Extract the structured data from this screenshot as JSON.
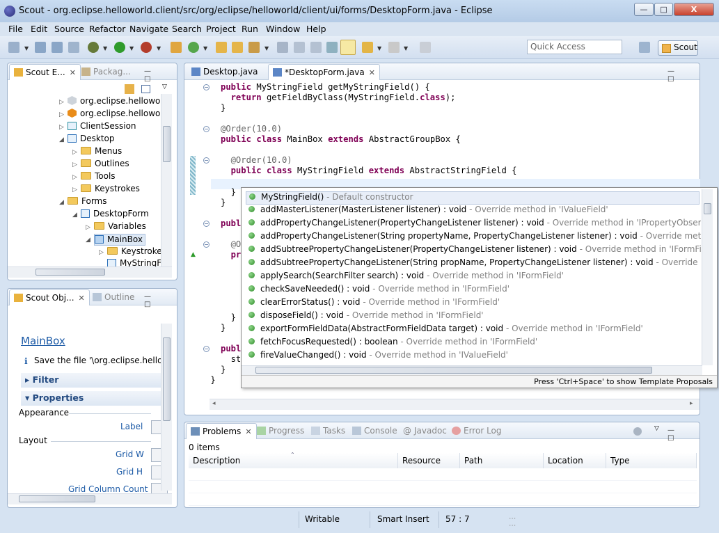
{
  "window": {
    "title": "Scout - org.eclipse.helloworld.client/src/org/eclipse/helloworld/client/ui/forms/DesktopForm.java - Eclipse",
    "min": "—",
    "max": "□",
    "close": "X"
  },
  "menu": [
    "File",
    "Edit",
    "Source",
    "Refactor",
    "Navigate",
    "Search",
    "Project",
    "Run",
    "Window",
    "Help"
  ],
  "toolbar": {
    "quick_access_placeholder": "Quick Access",
    "perspective": "Scout"
  },
  "explorer": {
    "tabs": [
      {
        "label": "Scout E...",
        "active": true
      },
      {
        "label": "Packag...",
        "active": false
      }
    ],
    "tree": [
      {
        "label": "org.eclipse.helloworld",
        "icon": "project-icon-gray"
      },
      {
        "label": "org.eclipse.helloworld",
        "icon": "project-icon-orange"
      },
      {
        "label": "ClientSession",
        "icon": "session-icon"
      },
      {
        "label": "Desktop",
        "icon": "desktop-icon"
      },
      {
        "label": "Menus",
        "icon": "folder-icon"
      },
      {
        "label": "Outlines",
        "icon": "folder-icon"
      },
      {
        "label": "Tools",
        "icon": "folder-icon"
      },
      {
        "label": "Keystrokes",
        "icon": "folder-icon"
      },
      {
        "label": "Forms",
        "icon": "folder-icon"
      },
      {
        "label": "DesktopForm",
        "icon": "form-icon"
      },
      {
        "label": "Variables",
        "icon": "folder-icon"
      },
      {
        "label": "MainBox",
        "icon": "groupbox-icon"
      },
      {
        "label": "Keystrokes",
        "icon": "folder-icon"
      },
      {
        "label": "MyStringFi",
        "icon": "field-icon"
      }
    ]
  },
  "properties": {
    "tabs": [
      {
        "label": "Scout Obj...",
        "active": true
      },
      {
        "label": "Outline",
        "active": false
      }
    ],
    "title_link": "MainBox",
    "info": "Save the file '\\org.eclipse.hellowor",
    "sections": [
      "Filter",
      "Properties"
    ],
    "groups": [
      "Appearance",
      "Layout"
    ],
    "fields": [
      "Label",
      "Grid W",
      "Grid H",
      "Grid Column Count"
    ]
  },
  "editor": {
    "tabs": [
      {
        "label": "Desktop.java",
        "active": false
      },
      {
        "label": "*DesktopForm.java",
        "active": true
      }
    ],
    "lines": [
      {
        "indent": 2,
        "parts": [
          [
            "kw",
            "public"
          ],
          [
            "t",
            " MyStringField getMyStringField() {"
          ]
        ]
      },
      {
        "indent": 3,
        "parts": [
          [
            "kw",
            "return"
          ],
          [
            "t",
            " getFieldByClass(MyStringField."
          ],
          [
            "kw",
            "class"
          ],
          [
            "t",
            ");"
          ]
        ]
      },
      {
        "indent": 2,
        "parts": [
          [
            "t",
            "}"
          ]
        ]
      },
      {
        "indent": 2,
        "parts": []
      },
      {
        "indent": 2,
        "parts": [
          [
            "ann",
            "@Order(10.0)"
          ]
        ]
      },
      {
        "indent": 2,
        "parts": [
          [
            "kw",
            "public"
          ],
          [
            "t",
            " "
          ],
          [
            "kw",
            "class"
          ],
          [
            "t",
            " MainBox "
          ],
          [
            "kw",
            "extends"
          ],
          [
            "t",
            " AbstractGroupBox {"
          ]
        ]
      },
      {
        "indent": 2,
        "parts": []
      },
      {
        "indent": 3,
        "parts": [
          [
            "ann",
            "@Order(10.0)"
          ]
        ]
      },
      {
        "indent": 3,
        "parts": [
          [
            "kw",
            "public"
          ],
          [
            "t",
            " "
          ],
          [
            "kw",
            "class"
          ],
          [
            "t",
            " MyStringField "
          ],
          [
            "kw",
            "extends"
          ],
          [
            "t",
            " AbstractStringField {"
          ]
        ]
      },
      {
        "indent": 3,
        "parts": []
      },
      {
        "indent": 3,
        "parts": [
          [
            "t",
            "}"
          ]
        ]
      },
      {
        "indent": 2,
        "parts": [
          [
            "t",
            "}"
          ]
        ]
      },
      {
        "indent": 2,
        "parts": []
      },
      {
        "indent": 2,
        "parts": [
          [
            "kw",
            "publ"
          ]
        ]
      },
      {
        "indent": 2,
        "parts": []
      },
      {
        "indent": 3,
        "parts": [
          [
            "ann",
            "@O"
          ]
        ]
      },
      {
        "indent": 3,
        "parts": [
          [
            "kw",
            "pr"
          ]
        ]
      },
      {
        "indent": 2,
        "parts": []
      },
      {
        "indent": 2,
        "parts": []
      },
      {
        "indent": 2,
        "parts": []
      },
      {
        "indent": 2,
        "parts": []
      },
      {
        "indent": 2,
        "parts": []
      },
      {
        "indent": 3,
        "parts": [
          [
            "t",
            "}"
          ]
        ]
      },
      {
        "indent": 2,
        "parts": [
          [
            "t",
            "}"
          ]
        ]
      },
      {
        "indent": 2,
        "parts": []
      },
      {
        "indent": 2,
        "parts": [
          [
            "kw",
            "publ"
          ]
        ]
      },
      {
        "indent": 3,
        "parts": [
          [
            "t",
            "st"
          ]
        ]
      },
      {
        "indent": 2,
        "parts": [
          [
            "t",
            "}"
          ]
        ]
      },
      {
        "indent": 1,
        "parts": [
          [
            "t",
            "}"
          ]
        ]
      }
    ]
  },
  "proposals": {
    "items": [
      {
        "name": "MyStringField()",
        "desc": " - Default constructor",
        "icon": "constructor-icon"
      },
      {
        "name": "addMasterListener(MasterListener listener) : void",
        "desc": " - Override method in 'IValueField'",
        "icon": "method-icon"
      },
      {
        "name": "addPropertyChangeListener(PropertyChangeListener listener) : void",
        "desc": " - Override method in 'IPropertyObserver'",
        "icon": "method-icon"
      },
      {
        "name": "addPropertyChangeListener(String propertyName, PropertyChangeListener listener) : void",
        "desc": " - Override method in 'IPropert",
        "icon": "method-icon"
      },
      {
        "name": "addSubtreePropertyChangeListener(PropertyChangeListener listener) : void",
        "desc": " - Override method in 'IFormField'",
        "icon": "method-icon"
      },
      {
        "name": "addSubtreePropertyChangeListener(String propName, PropertyChangeListener listener) : void",
        "desc": " - Override method in 'IFor",
        "icon": "method-icon"
      },
      {
        "name": "applySearch(SearchFilter search) : void",
        "desc": " - Override method in 'IFormField'",
        "icon": "method-icon"
      },
      {
        "name": "checkSaveNeeded() : void",
        "desc": " - Override method in 'IFormField'",
        "icon": "method-icon"
      },
      {
        "name": "clearErrorStatus() : void",
        "desc": " - Override method in 'IFormField'",
        "icon": "method-icon"
      },
      {
        "name": "disposeField() : void",
        "desc": " - Override method in 'IFormField'",
        "icon": "method-icon"
      },
      {
        "name": "exportFormFieldData(AbstractFormFieldData target) : void",
        "desc": " - Override method in 'IFormField'",
        "icon": "method-icon"
      },
      {
        "name": "fetchFocusRequested() : boolean",
        "desc": " - Override method in 'IFormField'",
        "icon": "method-icon"
      },
      {
        "name": "fireValueChanged() : void",
        "desc": " - Override method in 'IValueField'",
        "icon": "method-icon"
      }
    ],
    "footer": "Press 'Ctrl+Space' to show Template Proposals"
  },
  "problems": {
    "tabs": [
      {
        "label": "Problems",
        "active": true
      },
      {
        "label": "Progress"
      },
      {
        "label": "Tasks"
      },
      {
        "label": "Console"
      },
      {
        "label": "Javadoc"
      },
      {
        "label": "Error Log"
      }
    ],
    "count": "0 items",
    "columns": [
      "Description",
      "Resource",
      "Path",
      "Location",
      "Type"
    ]
  },
  "status": {
    "mode": "Writable",
    "insert": "Smart Insert",
    "pos": "57 : 7"
  }
}
